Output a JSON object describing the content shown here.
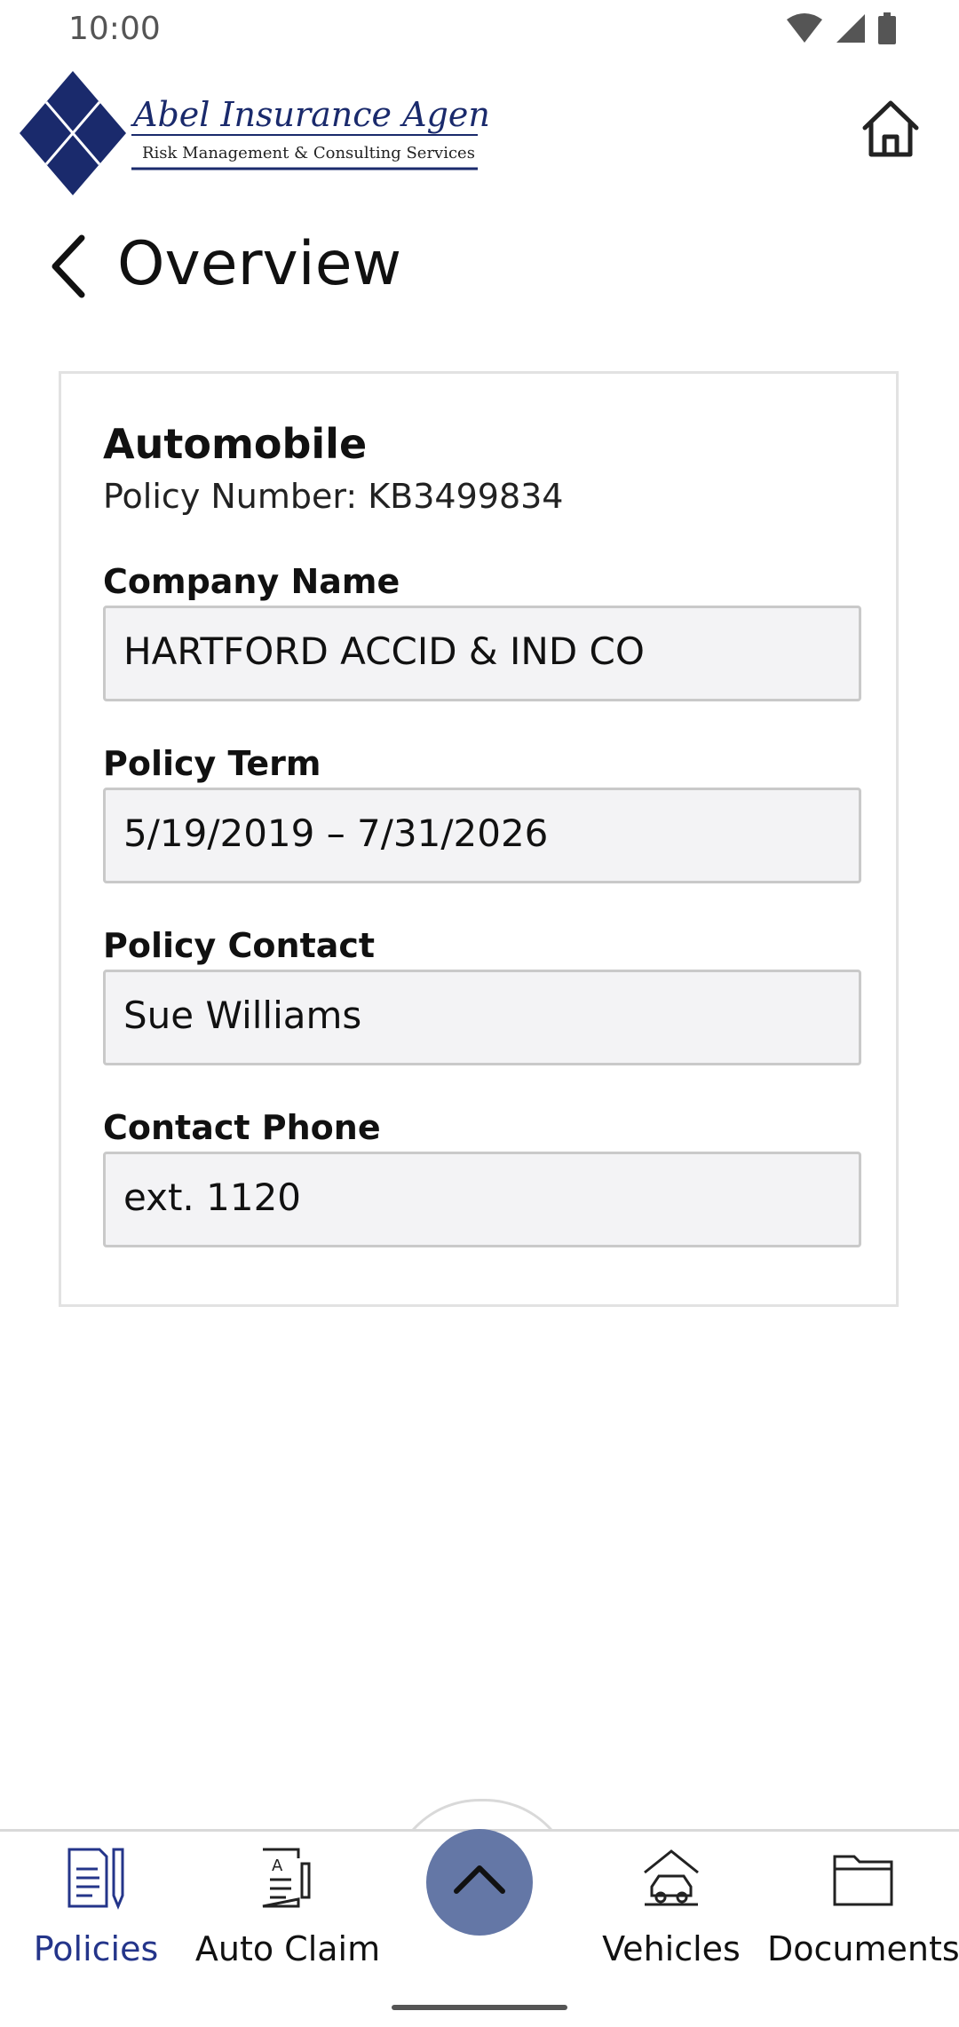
{
  "status": {
    "time": "10:00"
  },
  "brand": {
    "name": "Abel Insurance Agency",
    "tagline": "Risk Management & Consulting Services",
    "color": "#1a2a6c"
  },
  "header": {
    "title": "Overview"
  },
  "policy": {
    "type": "Automobile",
    "number_text": "Policy Number: KB3499834",
    "fields": [
      {
        "label": "Company Name",
        "value": "HARTFORD ACCID & IND CO"
      },
      {
        "label": "Policy Term",
        "value": "5/19/2019 – 7/31/2026"
      },
      {
        "label": "Policy Contact",
        "value": "Sue Williams"
      },
      {
        "label": "Contact Phone",
        "value": "ext. 1120"
      }
    ]
  },
  "bottom_nav": {
    "items": [
      {
        "label": "Policies",
        "icon": "policy-document-icon",
        "active": true
      },
      {
        "label": "Auto Claim",
        "icon": "claim-form-icon",
        "active": false
      },
      {
        "label": "Vehicles",
        "icon": "car-garage-icon",
        "active": false
      },
      {
        "label": "Documents",
        "icon": "folder-icon",
        "active": false
      }
    ],
    "center_button_icon": "chevron-up-icon"
  },
  "colors": {
    "active": "#24358a",
    "center_button": "#6477a6",
    "field_bg": "#f3f3f5"
  }
}
